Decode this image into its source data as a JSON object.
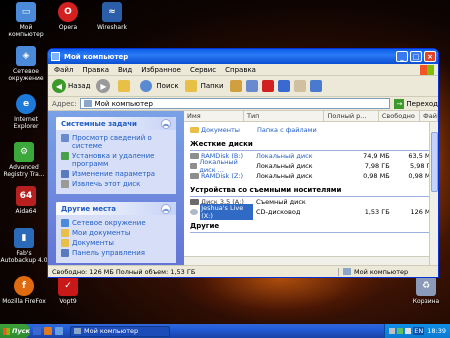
{
  "desktop": {
    "icons": [
      {
        "label": "Мой компьютер",
        "color": "#4a8ad8"
      },
      {
        "label": "Opera",
        "color": "#d42020"
      },
      {
        "label": "Wireshark",
        "color": "#2a5ea8"
      },
      {
        "label": "Сетевое окружение",
        "color": "#4a8ad8"
      },
      {
        "label": "Internet Explorer",
        "color": "#1e7ad8"
      },
      {
        "label": "Advanced Registry Tra...",
        "color": "#3aa83a"
      },
      {
        "label": "Aida64",
        "color": "#b82020"
      },
      {
        "label": "Fab's Autobackup 4.0",
        "color": "#2a6ab8"
      },
      {
        "label": "Mozilla FireFox",
        "color": "#e06a10"
      },
      {
        "label": "Vopt9",
        "color": "#c81818"
      },
      {
        "label": "Корзина",
        "color": "#8a9ab8"
      }
    ]
  },
  "window": {
    "title": "Мой компьютер",
    "menu": [
      "Файл",
      "Правка",
      "Вид",
      "Избранное",
      "Сервис",
      "Справка"
    ],
    "toolbar": {
      "back": "Назад",
      "search": "Поиск",
      "folders": "Папки"
    },
    "address": {
      "label": "Адрес:",
      "value": "Мой компьютер",
      "go": "Переход"
    },
    "tasks": {
      "system_title": "Системные задачи",
      "system_items": [
        "Просмотр сведений о системе",
        "Установка и удаление программ",
        "Изменение параметра",
        "Извлечь этот диск"
      ],
      "places_title": "Другие места",
      "places_items": [
        "Сетевое окружение",
        "Мои документы",
        "Документы",
        "Панель управления"
      ]
    },
    "columns": {
      "name": "Имя",
      "type": "Тип",
      "total": "Полный р...",
      "free": "Свободно",
      "fs": "Фай"
    },
    "files_row": {
      "name": "Документы",
      "type": "Папка с файлами"
    },
    "groups": {
      "hard": "Жесткие диски",
      "removable": "Устройства со съемными носителями",
      "other": "Другие"
    },
    "hard_disks": [
      {
        "name": "RAMDisk (B:)",
        "type": "Локальный диск",
        "total": "74,9 МБ",
        "free": "63,5 МБ"
      },
      {
        "name": "Локальный диск ...",
        "type": "Локальный диск",
        "total": "7,98 ГБ",
        "free": "5,98 ГБ"
      },
      {
        "name": "RAMDisk (Z:)",
        "type": "Локальный диск",
        "total": "0,98 МБ",
        "free": "0,98 МБ"
      }
    ],
    "removable": [
      {
        "name": "Диск 3,5 (A:)",
        "type": "Съемный диск",
        "total": "",
        "free": ""
      },
      {
        "name": "Jeshua's Live (X:)",
        "type": "CD-дисковод",
        "total": "1,53 ГБ",
        "free": "126 МБ"
      }
    ],
    "status": {
      "left": "Свободно: 126 МБ Полный объем: 1,53 ГБ",
      "right": "Мой компьютер"
    }
  },
  "taskbar": {
    "start": "Пуск",
    "task": "Мой компьютер",
    "lang": "EN",
    "clock": "18:39"
  }
}
